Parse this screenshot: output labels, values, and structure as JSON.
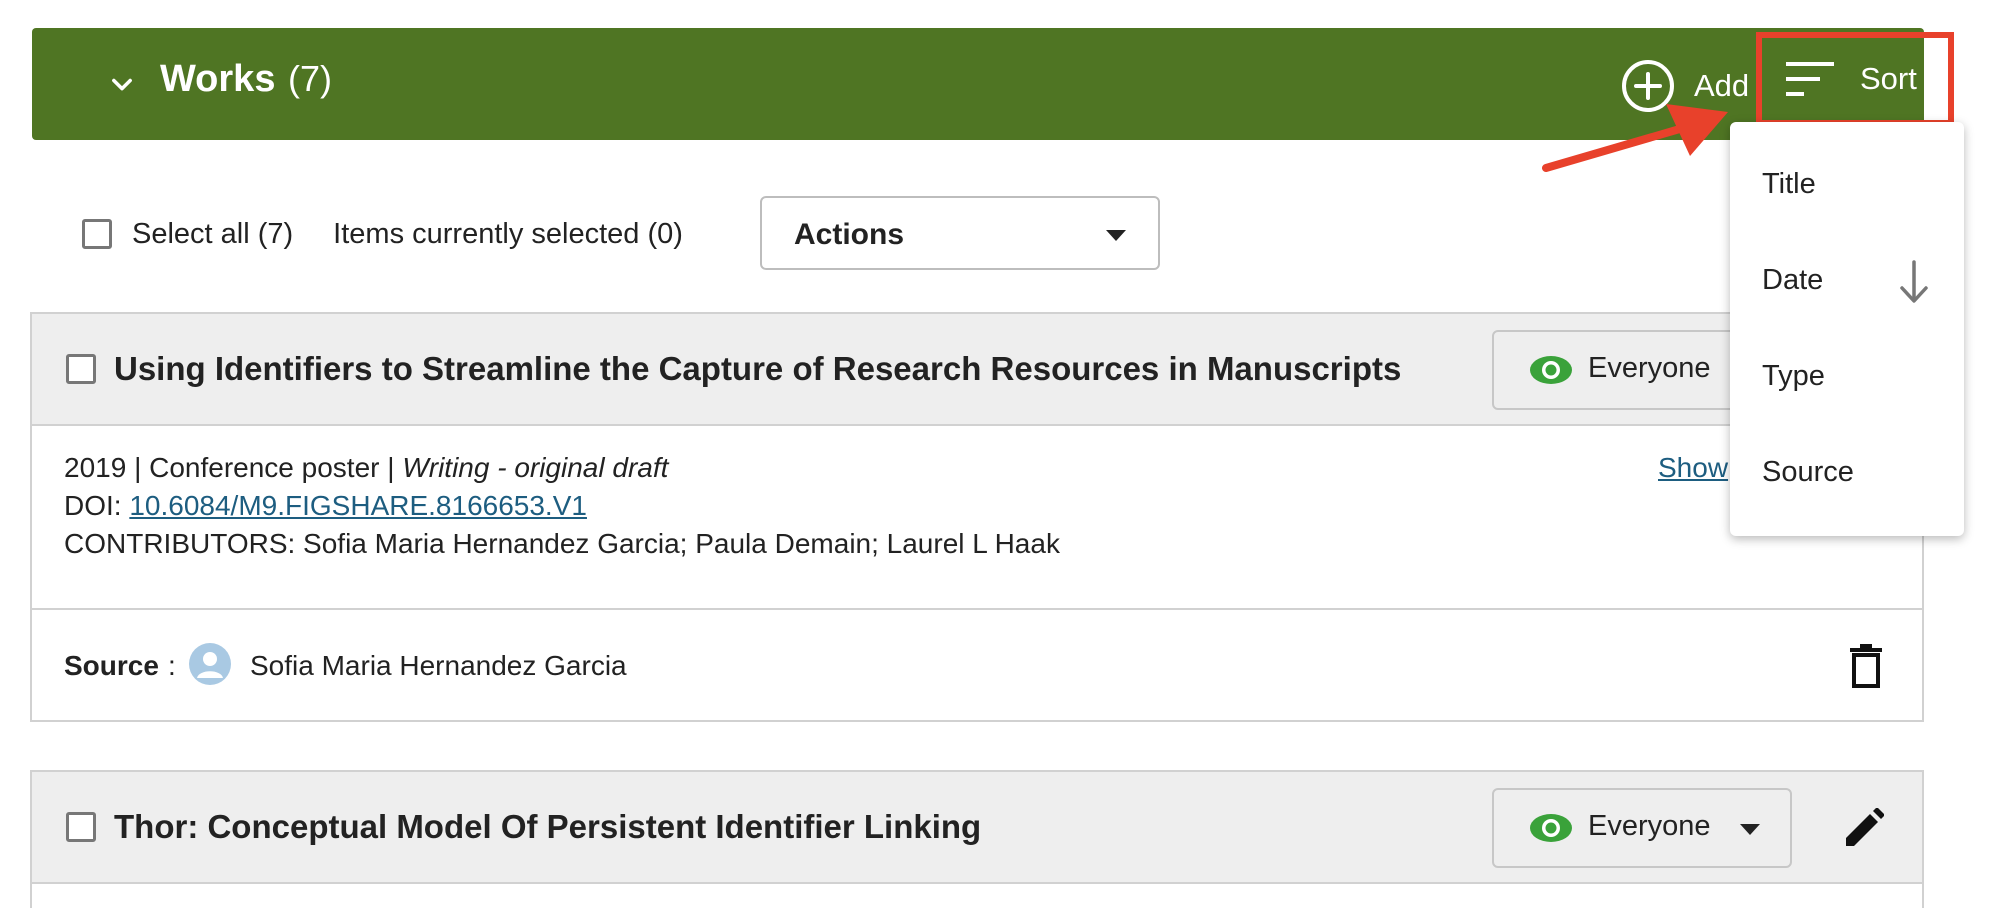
{
  "header": {
    "title": "Works",
    "count": "(7)",
    "add_label": "Add",
    "sort_label": "Sort"
  },
  "toolbar": {
    "select_all_label": "Select all (7)",
    "items_selected": "Items currently selected (0)",
    "actions_label": "Actions"
  },
  "sort_menu": {
    "items": [
      "Title",
      "Date",
      "Type",
      "Source"
    ],
    "active": "Date",
    "direction_icon": "arrow-down-icon"
  },
  "works": [
    {
      "title": "Using Identifiers to Streamline the Capture of Research Resources in Manuscripts",
      "visibility": "Everyone",
      "meta_prefix": "2019 | Conference poster | ",
      "role": "Writing - original draft",
      "doi_label": "DOI: ",
      "doi": "10.6084/M9.FIGSHARE.8166653.V1",
      "contributors": "CONTRIBUTORS: Sofia Maria Hernandez Garcia; Paula Demain; Laurel L Haak",
      "show_link": "Show",
      "source_label": "Source",
      "source_name": "Sofia Maria Hernandez Garcia"
    },
    {
      "title": "Thor: Conceptual Model Of Persistent Identifier Linking",
      "visibility": "Everyone"
    }
  ],
  "colors": {
    "header_bg": "#4f7523",
    "highlight": "#e8412b",
    "link": "#1d5d80",
    "eye": "#3aa23a"
  }
}
